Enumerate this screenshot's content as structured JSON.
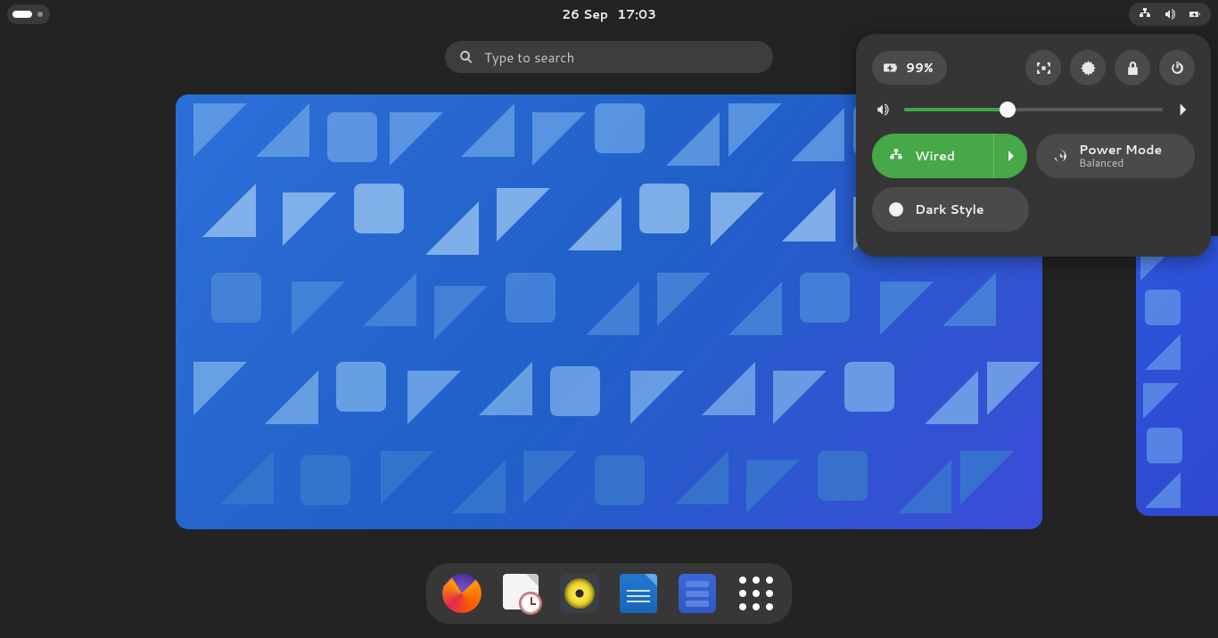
{
  "topbar": {
    "date": "26 Sep",
    "time": "17:03"
  },
  "search": {
    "placeholder": "Type to search"
  },
  "quick_settings": {
    "battery_percent": "99%",
    "volume_percent": 40,
    "tiles": {
      "network": {
        "label": "Wired"
      },
      "power_mode": {
        "label": "Power Mode",
        "sub": "Balanced"
      },
      "dark_style": {
        "label": "Dark Style"
      }
    }
  },
  "dock": {
    "items": [
      {
        "name": "firefox"
      },
      {
        "name": "calendar-clock"
      },
      {
        "name": "rhythmbox"
      },
      {
        "name": "writer"
      },
      {
        "name": "files"
      },
      {
        "name": "apps-grid"
      }
    ]
  }
}
